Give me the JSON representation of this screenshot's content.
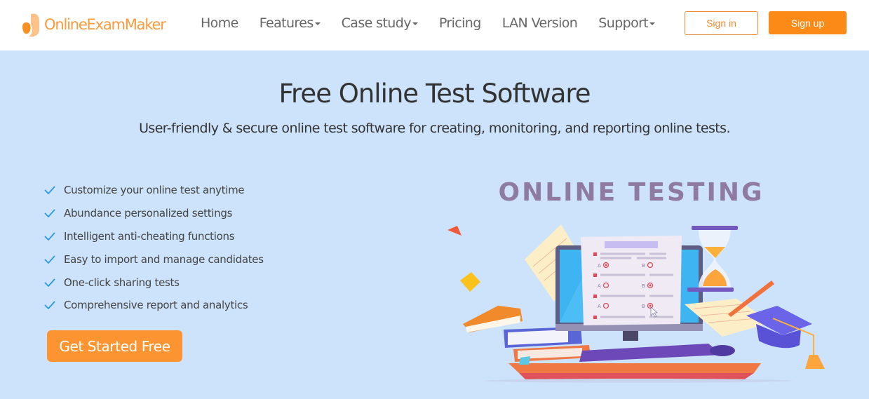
{
  "nav": {
    "logo_text": "OnlineExamMaker",
    "items": [
      {
        "label": "Home",
        "dropdown": false
      },
      {
        "label": "Features",
        "dropdown": true
      },
      {
        "label": "Case study",
        "dropdown": true
      },
      {
        "label": "Pricing",
        "dropdown": false
      },
      {
        "label": "LAN Version",
        "dropdown": false
      },
      {
        "label": "Support",
        "dropdown": true
      }
    ],
    "signin_label": "Sign in",
    "signup_label": "Sign up"
  },
  "hero": {
    "title": "Free Online Test Software",
    "subtitle": "User-friendly & secure online test software for creating, monitoring, and reporting online tests.",
    "features": [
      "Customize your online test anytime",
      "Abundance personalized settings",
      "Intelligent anti-cheating functions",
      "Easy to import and manage candidates",
      "One-click sharing tests",
      "Comprehensive report and analytics"
    ],
    "cta_label": "Get Started Free"
  },
  "illustration": {
    "title": "ONLINE TESTING",
    "quiz_option_labels": [
      "A",
      "B"
    ]
  },
  "colors": {
    "brand_orange": "#fb8a17",
    "background": "#cde3fb",
    "check_blue": "#2a9be0",
    "illustration_title": "#8f7aa2"
  }
}
